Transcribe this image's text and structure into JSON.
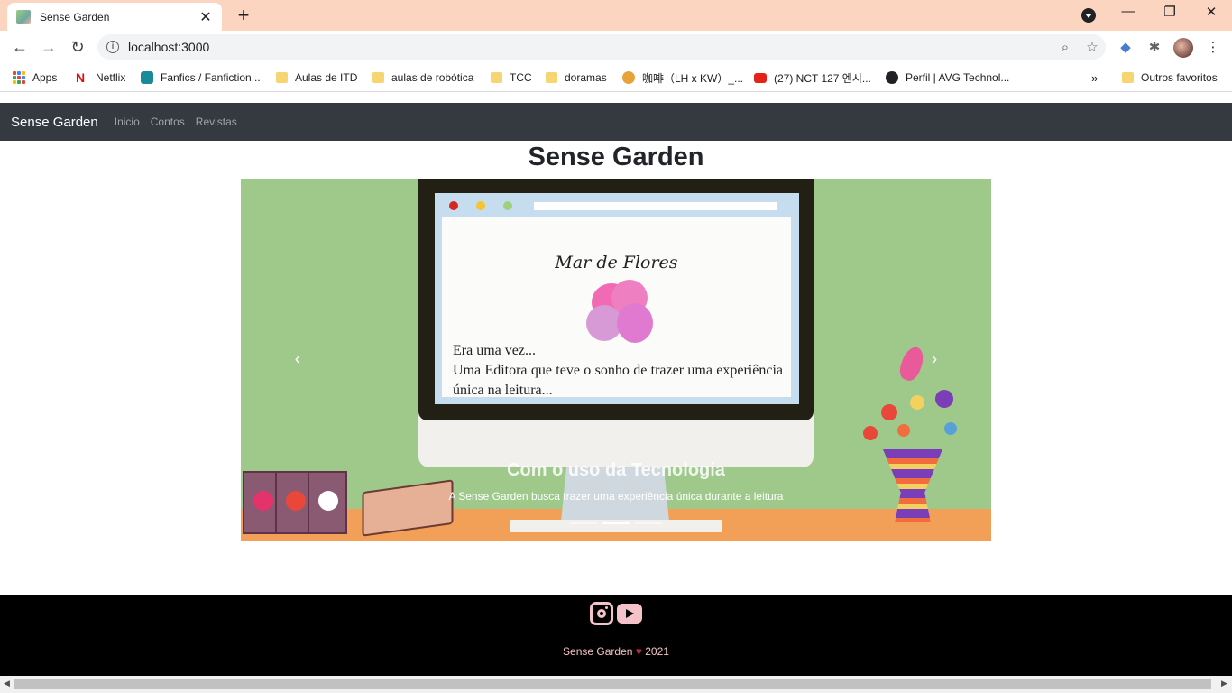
{
  "browser": {
    "tab_title": "Sense Garden",
    "url": "localhost:3000",
    "bookmarks": [
      {
        "label": "Apps",
        "icon": "apps-grid-icon"
      },
      {
        "label": "Netflix",
        "icon": "netflix-icon"
      },
      {
        "label": "Fanfics / Fanfiction...",
        "icon": "fanfiction-icon"
      },
      {
        "label": "Aulas de ITD",
        "icon": "folder-icon"
      },
      {
        "label": "aulas de robótica",
        "icon": "folder-icon"
      },
      {
        "label": "TCC",
        "icon": "folder-icon"
      },
      {
        "label": "doramas",
        "icon": "folder-icon"
      },
      {
        "label": "咖啡（LH x KW）_...",
        "icon": "bookmark-site-icon"
      },
      {
        "label": "(27) NCT 127 엔시...",
        "icon": "youtube-icon"
      },
      {
        "label": "Perfil | AVG Technol...",
        "icon": "globe-icon"
      }
    ],
    "other_bookmarks": "Outros favoritos",
    "tab_bar_color": "#fbd5c0"
  },
  "site": {
    "brand": "Sense Garden",
    "nav": [
      "Inicio",
      "Contos",
      "Revistas"
    ],
    "heading": "Sense Garden",
    "carousel": {
      "slide_logo": "Mar de Flores",
      "slide_text_line1": "Era uma vez...",
      "slide_text_line2": "Uma Editora que teve o sonho de trazer uma experiência única na leitura...",
      "caption_title": "Com o uso da Tecnologia",
      "caption_text": "A Sense Garden busca trazer uma experiência única durante a leitura",
      "slide_count": 3,
      "active_index": 1
    },
    "footer": {
      "brand": "Sense Garden",
      "year": "2021",
      "social": [
        "instagram-icon",
        "youtube-icon"
      ],
      "accent": "#f4c2c8"
    },
    "navbar_color": "#343a40"
  }
}
